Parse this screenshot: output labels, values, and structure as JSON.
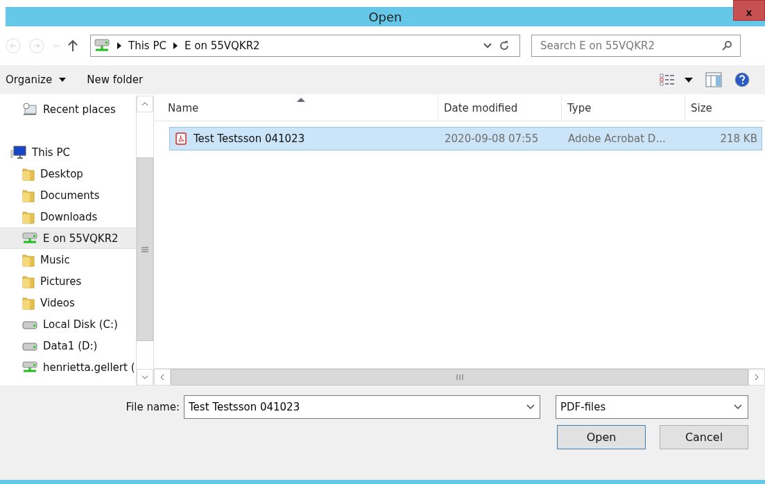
{
  "window": {
    "title": "Open",
    "close_label": "x"
  },
  "address": {
    "path": [
      {
        "label": "This PC"
      },
      {
        "label": "E on 55VQKR2"
      }
    ]
  },
  "search": {
    "placeholder": "Search E on 55VQKR2"
  },
  "toolbar": {
    "organize": "Organize",
    "new_folder": "New folder"
  },
  "sidebar": {
    "items": [
      {
        "label": "Recent places",
        "kind": "recent",
        "selected": false
      },
      {
        "label": "This PC",
        "kind": "pc",
        "selected": false,
        "children": [
          {
            "label": "Desktop",
            "kind": "folder",
            "selected": false
          },
          {
            "label": "Documents",
            "kind": "folder",
            "selected": false
          },
          {
            "label": "Downloads",
            "kind": "folder",
            "selected": false
          },
          {
            "label": "E on 55VQKR2",
            "kind": "network",
            "selected": true
          },
          {
            "label": "Music",
            "kind": "folder",
            "selected": false
          },
          {
            "label": "Pictures",
            "kind": "folder",
            "selected": false
          },
          {
            "label": "Videos",
            "kind": "folder",
            "selected": false
          },
          {
            "label": "Local Disk (C:)",
            "kind": "disk",
            "selected": false
          },
          {
            "label": "Data1 (D:)",
            "kind": "disk",
            "selected": false
          },
          {
            "label": "henrietta.gellert (",
            "kind": "network",
            "selected": false
          }
        ]
      }
    ]
  },
  "table": {
    "columns": [
      "Name",
      "Date modified",
      "Type",
      "Size"
    ],
    "rows": [
      {
        "name": "Test Testsson 041023",
        "date": "2020-09-08 07:55",
        "type": "Adobe Acrobat D...",
        "size": "218 KB",
        "selected": true
      }
    ]
  },
  "file_name": {
    "label": "File name:",
    "value": "Test Testsson 041023"
  },
  "file_type": {
    "value": "PDF-files"
  },
  "buttons": [
    "Open",
    "Cancel"
  ]
}
